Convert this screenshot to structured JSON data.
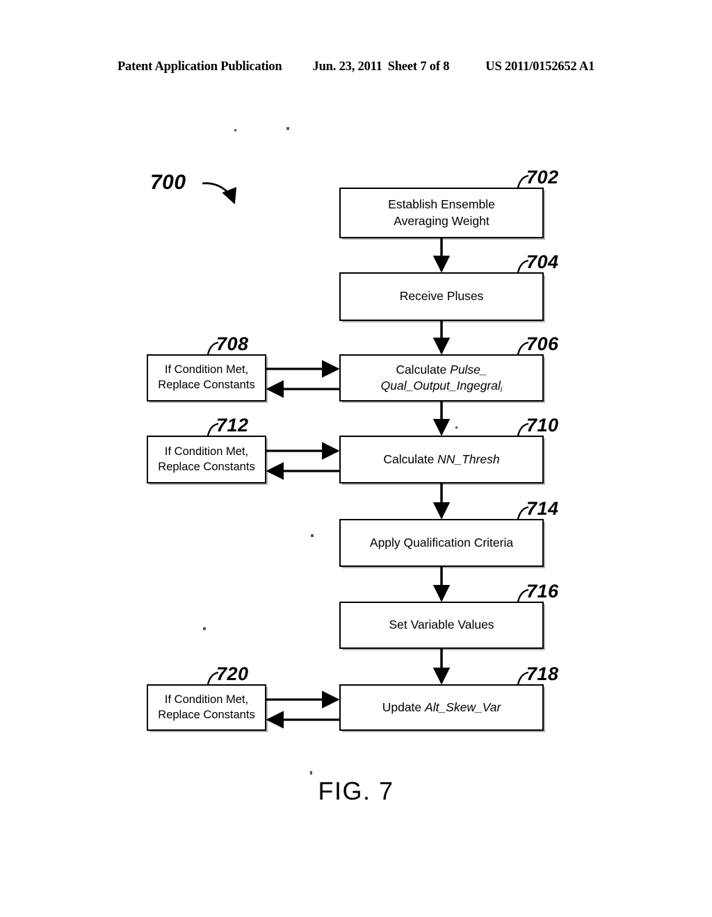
{
  "header": {
    "publication": "Patent Application Publication",
    "date": "Jun. 23, 2011",
    "sheet": "Sheet 7 of 8",
    "patent_number": "US 2011/0152652 A1"
  },
  "figure": {
    "caption": "FIG. 7",
    "diagram_ref": "700",
    "type": "flowchart"
  },
  "nodes": {
    "n702": {
      "ref": "702",
      "line1": "Establish Ensemble",
      "line2": "Averaging Weight"
    },
    "n704": {
      "ref": "704",
      "line1": "Receive Pluses"
    },
    "n706": {
      "ref": "706",
      "prefix": "Calculate ",
      "var_line1": "Pulse_",
      "var_line2": "Qual_Output_Ingegral",
      "subscript": "i"
    },
    "n708": {
      "ref": "708",
      "line1": "If Condition Met,",
      "line2": "Replace Constants"
    },
    "n710": {
      "ref": "710",
      "prefix": "Calculate ",
      "var": "NN_Thresh"
    },
    "n712": {
      "ref": "712",
      "line1": "If Condition Met,",
      "line2": "Replace Constants"
    },
    "n714": {
      "ref": "714",
      "line1": "Apply Qualification Criteria"
    },
    "n716": {
      "ref": "716",
      "line1": "Set Variable Values"
    },
    "n718": {
      "ref": "718",
      "prefix": "Update ",
      "var": "Alt_Skew_Var"
    },
    "n720": {
      "ref": "720",
      "line1": "If Condition Met,",
      "line2": "Replace Constants"
    }
  },
  "colors": {
    "ink": "#000000",
    "paper": "#ffffff"
  }
}
